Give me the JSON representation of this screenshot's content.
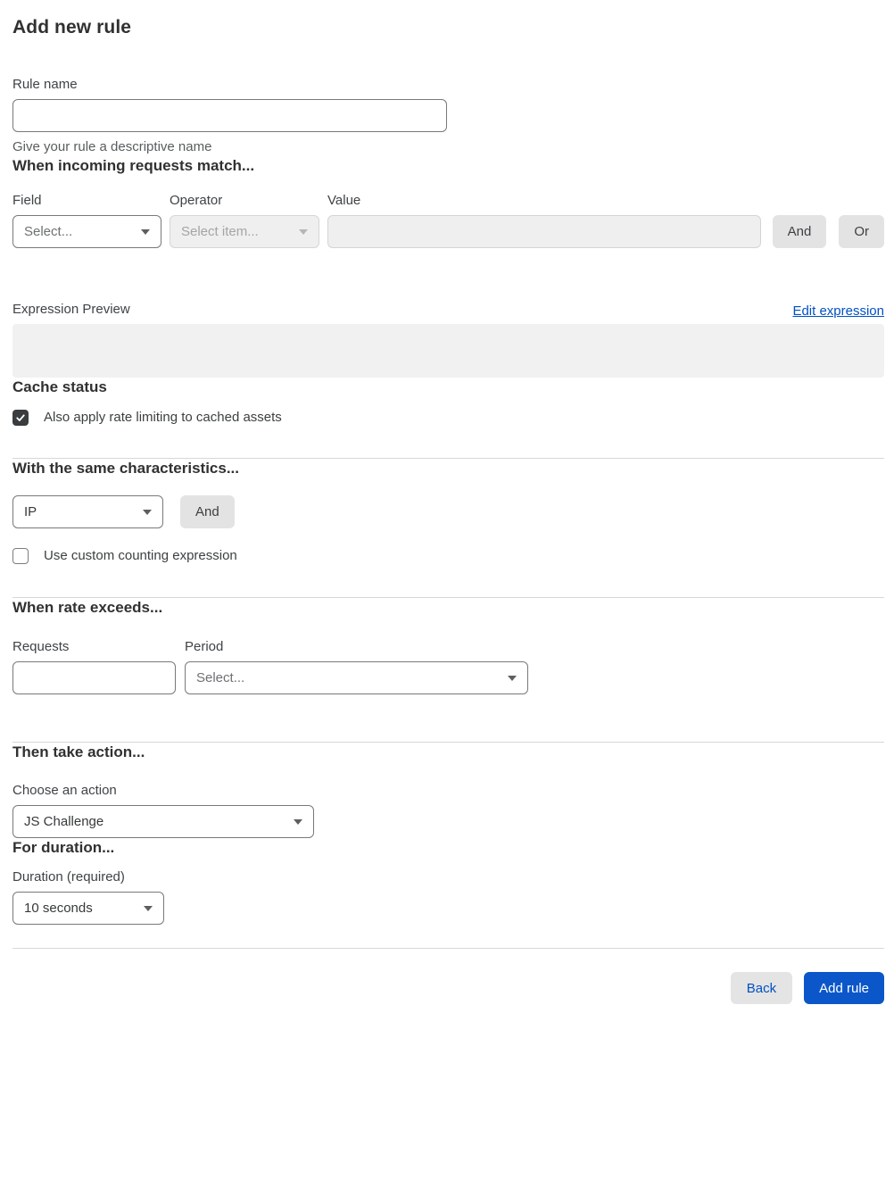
{
  "page": {
    "title": "Add new rule"
  },
  "rule_name": {
    "label": "Rule name",
    "value": "",
    "helper": "Give your rule a descriptive name"
  },
  "match_section": {
    "heading": "When incoming requests match...",
    "field": {
      "label": "Field",
      "selected": "Select..."
    },
    "operator": {
      "label": "Operator",
      "selected": "Select item...",
      "disabled": true
    },
    "value": {
      "label": "Value",
      "value": "",
      "disabled": true
    },
    "and_button": "And",
    "or_button": "Or"
  },
  "expression_preview": {
    "label": "Expression Preview",
    "edit_link": "Edit expression",
    "value": ""
  },
  "cache_status": {
    "heading": "Cache status",
    "checkbox_label": "Also apply rate limiting to cached assets",
    "checked": true
  },
  "characteristics": {
    "heading": "With the same characteristics...",
    "selected": "IP",
    "and_button": "And",
    "counting_checkbox_label": "Use custom counting expression",
    "counting_checked": false
  },
  "rate_section": {
    "heading": "When rate exceeds...",
    "requests": {
      "label": "Requests",
      "value": ""
    },
    "period": {
      "label": "Period",
      "selected": "Select..."
    }
  },
  "action_section": {
    "heading": "Then take action...",
    "label": "Choose an action",
    "selected": "JS Challenge"
  },
  "duration_section": {
    "heading": "For duration...",
    "label": "Duration (required)",
    "selected": "10 seconds"
  },
  "footer": {
    "back_button": "Back",
    "add_rule_button": "Add rule"
  },
  "icons": {
    "chevron_down": "chevron-down-icon",
    "checkmark": "checkmark-icon"
  },
  "colors": {
    "primary_button_blue": "#0b57c9",
    "link_blue": "#0051c3",
    "gray_button": "#e3e3e3",
    "disabled_field_bg": "#efefef",
    "checked_checkbox": "#3a3d3f",
    "preview_box_bg": "#f1f1f1",
    "divider": "#d7d7d7",
    "text_dark": "#36393a"
  }
}
